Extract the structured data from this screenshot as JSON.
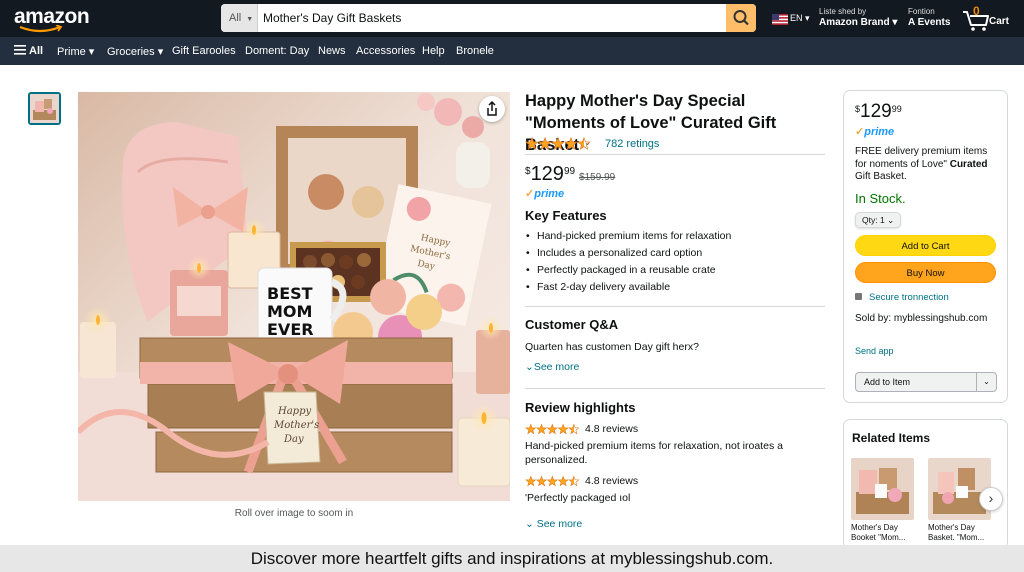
{
  "header": {
    "logo": "amazon",
    "search": {
      "category": "All",
      "query": "Mother's Day Gift Baskets"
    },
    "lang": "EN",
    "account": {
      "line1": "Liste shed by",
      "line2": "Amazon Brand"
    },
    "returns": {
      "line1": "Fontion",
      "line2": "A Events"
    },
    "cart": {
      "count": "0",
      "label": "Cart"
    }
  },
  "nav": {
    "all": "All",
    "items": [
      "Prime",
      "Groceries",
      "Gift Earooles",
      "Doment: Day",
      "News",
      "Accessories",
      "Help",
      "Bronele"
    ]
  },
  "gallery": {
    "rollover": "Roll over image to soom in"
  },
  "product": {
    "title": "Happy Mother's Day Special \"Moments of Love\" Curated Gift Basket",
    "rating": 4.5,
    "ratings_count": "782 retings",
    "price": {
      "symbol": "$",
      "whole": "129",
      "fraction": "99",
      "list_price": "$159.99"
    },
    "prime": "prime",
    "features_heading": "Key Features",
    "features": [
      "Hand-picked premium items for relaxation",
      "Includes a personalized card option",
      "Perfectly packaged in a reusable crate",
      "Fast 2-day delivery available"
    ],
    "qa_heading": "Customer Q&A",
    "qa_text": "Quarten has customen Day gift herx?",
    "qa_see_more": "See more",
    "review_heading": "Review highlights",
    "reviews": [
      {
        "rating": 4.5,
        "text": "4.8 reviews",
        "body": "Hand-picked premium items for relaxation, not iroates a personalized."
      },
      {
        "rating": 4.5,
        "text": "4.8 reviews",
        "body": "'Perfectly packaged ıol"
      }
    ],
    "review_see_more": "See more"
  },
  "buybox": {
    "price": {
      "symbol": "$",
      "whole": "129",
      "fraction": "99"
    },
    "prime": "prime",
    "delivery_pre": "FREE delivery premium items for noments of Love\"",
    "delivery_bold": "Curated",
    "delivery_post": "Gift Basket.",
    "stock": "In Stock.",
    "qty": "Qty: 1",
    "add_to_cart": "Add to Cart",
    "buy_now": "Buy Now",
    "secure": "Secure tronnection",
    "sold_by": "Sold by: myblessingshub.com",
    "send_app": "Send app",
    "add_to_item": "Add to Item"
  },
  "related": {
    "heading": "Related Items",
    "items": [
      {
        "caption": "Mother's Day Booket \"Mom..."
      },
      {
        "caption": "Mother's Day Basket. \"Mom..."
      }
    ]
  },
  "banner": "Discover more heartfelt gifts and inspirations at myblessingshub.com.",
  "colors": {
    "header": "#131921",
    "nav": "#232f3e",
    "cart_button": "#ffd814",
    "buy_button": "#ffa41c",
    "link": "#007185",
    "in_stock": "#007600",
    "star": "#ffa41c"
  }
}
